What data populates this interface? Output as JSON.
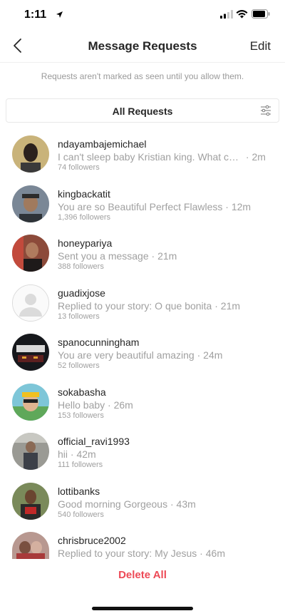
{
  "status_bar": {
    "time": "1:11"
  },
  "nav": {
    "title": "Message Requests",
    "edit_label": "Edit"
  },
  "notice": "Requests aren't marked as seen until you allow them.",
  "filter": {
    "label": "All Requests"
  },
  "requests": [
    {
      "username": "ndayambajemichael",
      "message": "I can't sleep baby Kristian king. What can I...",
      "time": "2m",
      "followers": "74 followers"
    },
    {
      "username": "kingbackatit",
      "message": "You are so Beautiful Perfect Flawless",
      "time": "12m",
      "followers": "1,396 followers"
    },
    {
      "username": "honeypariya",
      "message": "Sent you a message",
      "time": "21m",
      "followers": "388 followers"
    },
    {
      "username": "guadixjose",
      "message": "Replied to your story: O que bonita",
      "time": "21m",
      "followers": "13 followers"
    },
    {
      "username": "spanocunningham",
      "message": "You are very beautiful amazing",
      "time": "24m",
      "followers": "52 followers"
    },
    {
      "username": "sokabasha",
      "message": "Hello baby",
      "time": "26m",
      "followers": "153 followers"
    },
    {
      "username": "official_ravi1993",
      "message": "hii",
      "time": "42m",
      "followers": "111 followers"
    },
    {
      "username": "lottibanks",
      "message": "Good morning Gorgeous",
      "time": "43m",
      "followers": "540 followers"
    },
    {
      "username": "chrisbruce2002",
      "message": "Replied to your story: My Jesus",
      "time": "46m",
      "followers": ""
    }
  ],
  "footer": {
    "delete_all_label": "Delete All"
  },
  "colors": {
    "delete": "#ed4956",
    "secondary_text": "#a0a0a0",
    "divider": "#efefef"
  },
  "icons": [
    "location-arrow-icon",
    "signal-icon",
    "wifi-icon",
    "battery-icon",
    "back-chevron-icon",
    "filter-sliders-icon",
    "default-avatar-icon"
  ]
}
